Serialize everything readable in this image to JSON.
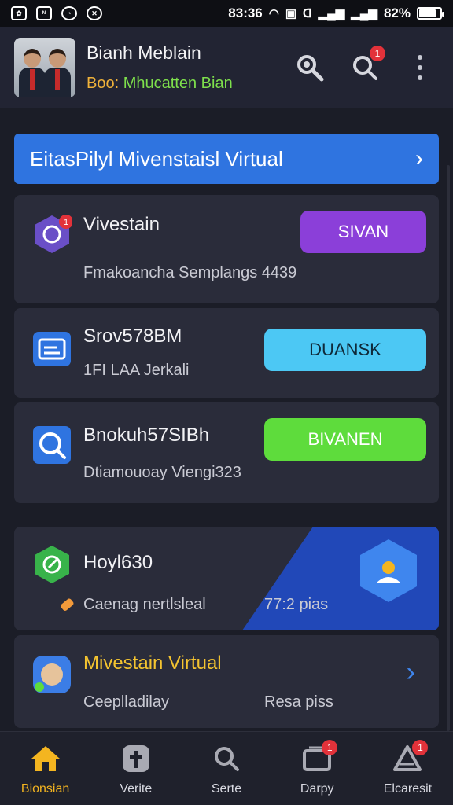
{
  "status_bar": {
    "time": "83:36",
    "battery": "82%",
    "battery_level": 0.82
  },
  "header": {
    "name": "Bianh Meblain",
    "sub_key": "Boo:",
    "sub_value": "Mhucatten Bian",
    "notification_count": "1"
  },
  "banner": {
    "label": "EitasPilyl Mivenstaisl Virtual"
  },
  "cards": [
    {
      "title": "Vivestain",
      "desc": "Fmakoancha Semplangs 4439",
      "button": "SIVAN",
      "badge": "1"
    },
    {
      "title": "Srov578BM",
      "desc": "1FI LAA Jerkali",
      "button": "DUANSK"
    },
    {
      "title": "Bnokuh57SIBh",
      "desc": "Dtiamouoay Viengi323",
      "button": "BIVANEN"
    },
    {
      "title": "Hoyl630",
      "desc": "Caenag nertlsleal",
      "meta": "77:2 pias"
    },
    {
      "title": "Mivestain Virtual",
      "desc": "Ceeplladilay",
      "meta": "Resa piss"
    }
  ],
  "bottom_nav": [
    {
      "label": "Bionsian"
    },
    {
      "label": "Verite"
    },
    {
      "label": "Serte"
    },
    {
      "label": "Darpy",
      "badge": "1"
    },
    {
      "label": "Elcaresit",
      "badge": "1"
    }
  ],
  "colors": {
    "accent": "#2f74e0",
    "purple": "#8b3fd9",
    "cyan": "#4cc8f4",
    "green": "#5edc3c",
    "gold": "#f4b520"
  }
}
